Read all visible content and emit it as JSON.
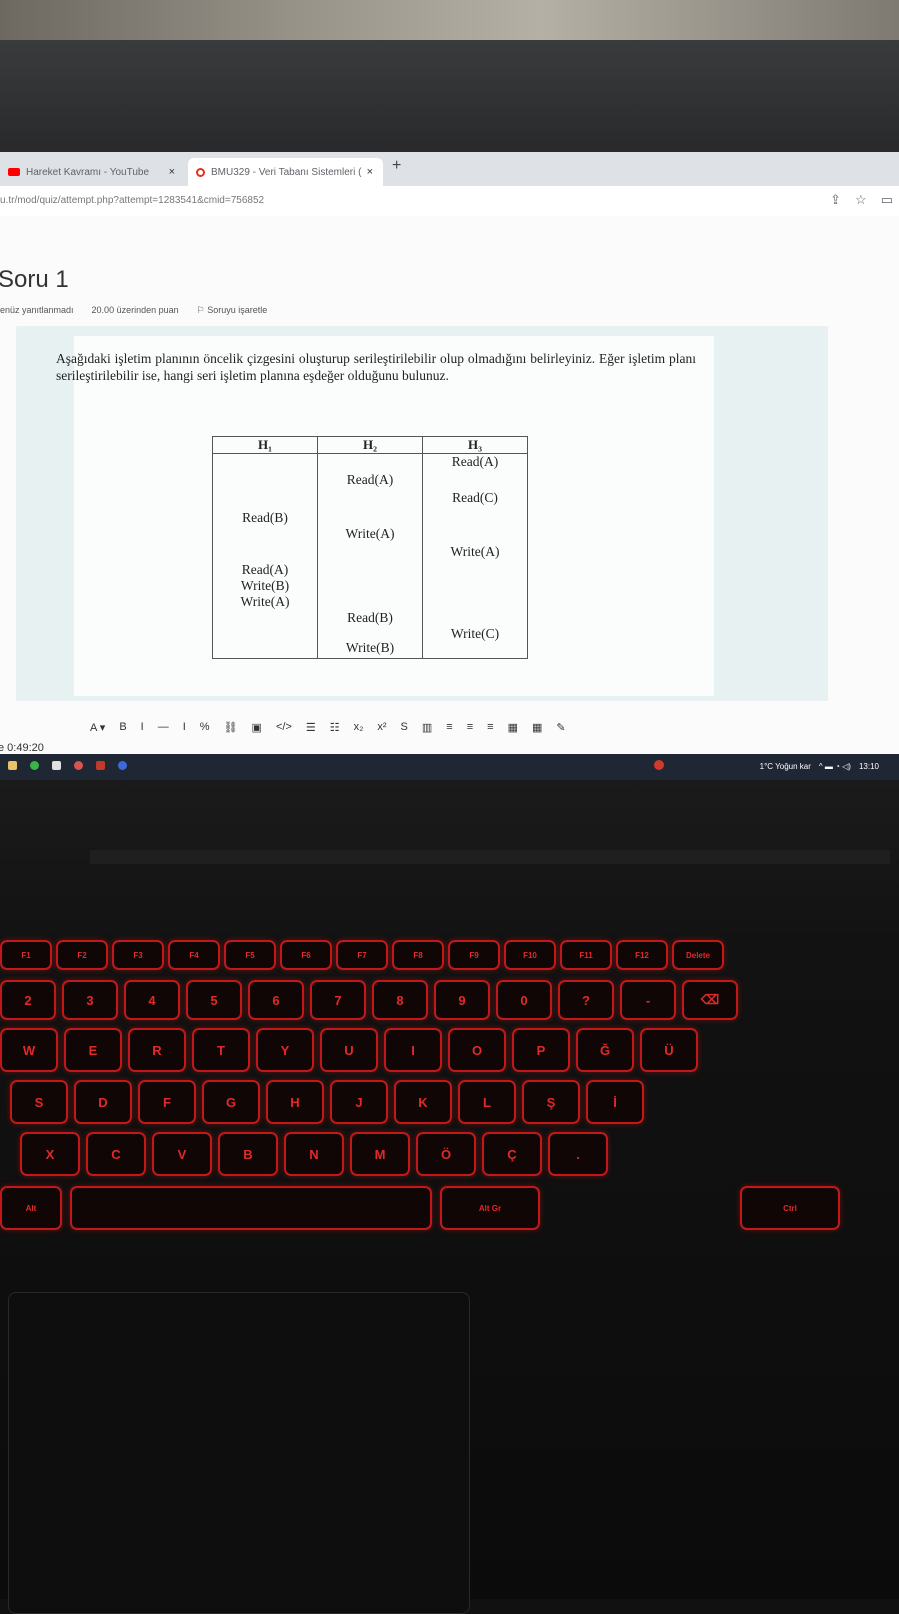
{
  "browser": {
    "tabs": [
      {
        "label": "Hareket Kavramı - YouTube",
        "close": "×"
      },
      {
        "label": "BMU329 - Veri Tabanı Sistemleri (",
        "close": "×"
      }
    ],
    "new_tab": "+",
    "url": "u.tr/mod/quiz/attempt.php?attempt=1283541&cmid=756852"
  },
  "question": {
    "title": "Soru 1",
    "status": "enüz yanıtlanmadı",
    "points": "20.00 üzerinden puan",
    "flag": "Soruyu işaretle",
    "text": "Aşağıdaki işletim planının öncelik çizgesini oluşturup serileştirilebilir olup olmadığını belirleyiniz. Eğer işletim planı serileştirilebilir ise, hangi seri işletim planına eşdeğer olduğunu bulunuz.",
    "schedule": {
      "headers": [
        "H₁",
        "H₂",
        "H₃"
      ],
      "h1_ops": [
        "Read(B)",
        "Read(A)",
        "Write(B)",
        "Write(A)"
      ],
      "h2_ops": [
        "Read(A)",
        "Write(A)",
        "Read(B)",
        "Write(B)"
      ],
      "h3_ops": [
        "Read(A)",
        "Read(C)",
        "Write(A)",
        "Write(C)"
      ]
    }
  },
  "editor": {
    "buttons": [
      "A ▾",
      "B",
      "I",
      "—",
      "I",
      "%",
      "⛓",
      "▣",
      "</>",
      "☰",
      "☷",
      "x₂",
      "x²",
      "S",
      "▥",
      "≡",
      "≡",
      "≡",
      "▦",
      "▦",
      "✎"
    ]
  },
  "timer": "e 0:49:20",
  "taskbar": {
    "weather": "1°C  Yoğun kar",
    "time": "13:10"
  },
  "keyboard": {
    "row_f": [
      "F1",
      "F2",
      "F3",
      "F4",
      "F5",
      "F6",
      "F7",
      "F8",
      "F9",
      "F10",
      "F11",
      "F12",
      "Delete"
    ],
    "row_num": [
      "2",
      "3",
      "4",
      "5",
      "6",
      "7",
      "8",
      "9",
      "0",
      "?",
      "-",
      "⌫"
    ],
    "row_q": [
      "W",
      "E",
      "R",
      "T",
      "Y",
      "U",
      "I",
      "O",
      "P",
      "Ğ",
      "Ü"
    ],
    "row_a": [
      "S",
      "D",
      "F",
      "G",
      "H",
      "J",
      "K",
      "L",
      "Ş",
      "İ"
    ],
    "row_z": [
      "X",
      "C",
      "V",
      "B",
      "N",
      "M",
      "Ö",
      "Ç",
      "."
    ],
    "row_bottom": [
      "Alt",
      "Alt Gr",
      "Ctrl"
    ]
  },
  "colors": {
    "keyboard_backlight": "#e02a2a",
    "taskbar": "#1e2733",
    "question_bg": "#e7f1f2"
  }
}
